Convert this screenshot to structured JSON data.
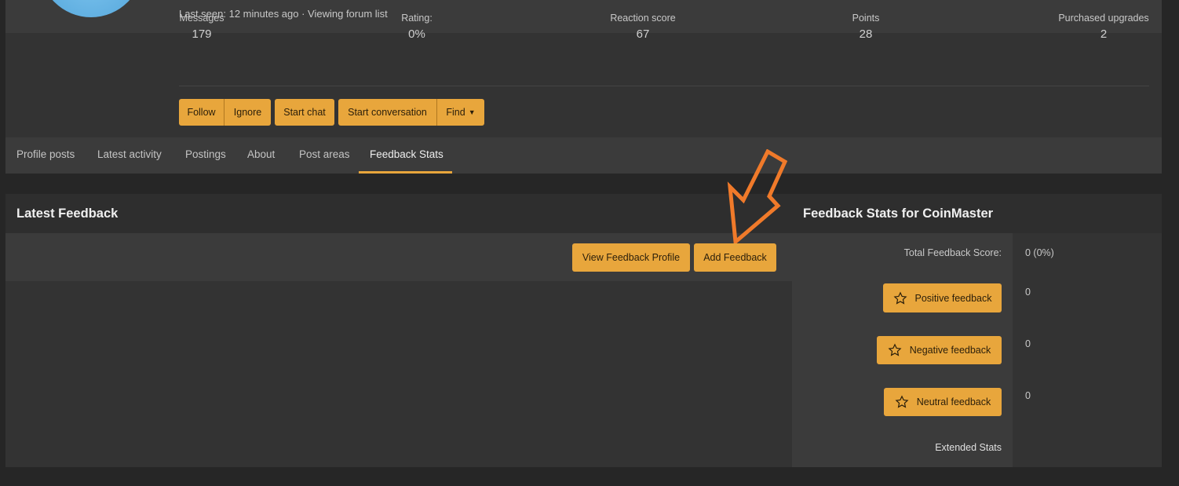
{
  "profile": {
    "last_seen": "Last seen: 12 minutes ago · Viewing forum list"
  },
  "stats": [
    {
      "label": "Messages",
      "value": "179"
    },
    {
      "label": "Rating:",
      "value": "0%"
    },
    {
      "label": "Reaction score",
      "value": "67"
    },
    {
      "label": "Points",
      "value": "28"
    },
    {
      "label": "Purchased upgrades",
      "value": "2"
    }
  ],
  "actions": {
    "follow": "Follow",
    "ignore": "Ignore",
    "start_chat": "Start chat",
    "start_conversation": "Start conversation",
    "find": "Find"
  },
  "tabs": [
    "Profile posts",
    "Latest activity",
    "Postings",
    "About",
    "Post areas",
    "Feedback Stats"
  ],
  "active_tab": "Feedback Stats",
  "latest": {
    "title": "Latest Feedback",
    "view_profile": "View Feedback Profile",
    "add": "Add Feedback"
  },
  "feedback_stats": {
    "title": "Feedback Stats for CoinMaster",
    "total_label": "Total Feedback Score:",
    "total_value": "0 (0%)",
    "positive_label": "Positive feedback",
    "positive_value": "0",
    "negative_label": "Negative feedback",
    "negative_value": "0",
    "neutral_label": "Neutral feedback",
    "neutral_value": "0",
    "extended": "Extended Stats"
  },
  "colors": {
    "accent": "#e8a63c",
    "arrow": "#f07a2a"
  }
}
